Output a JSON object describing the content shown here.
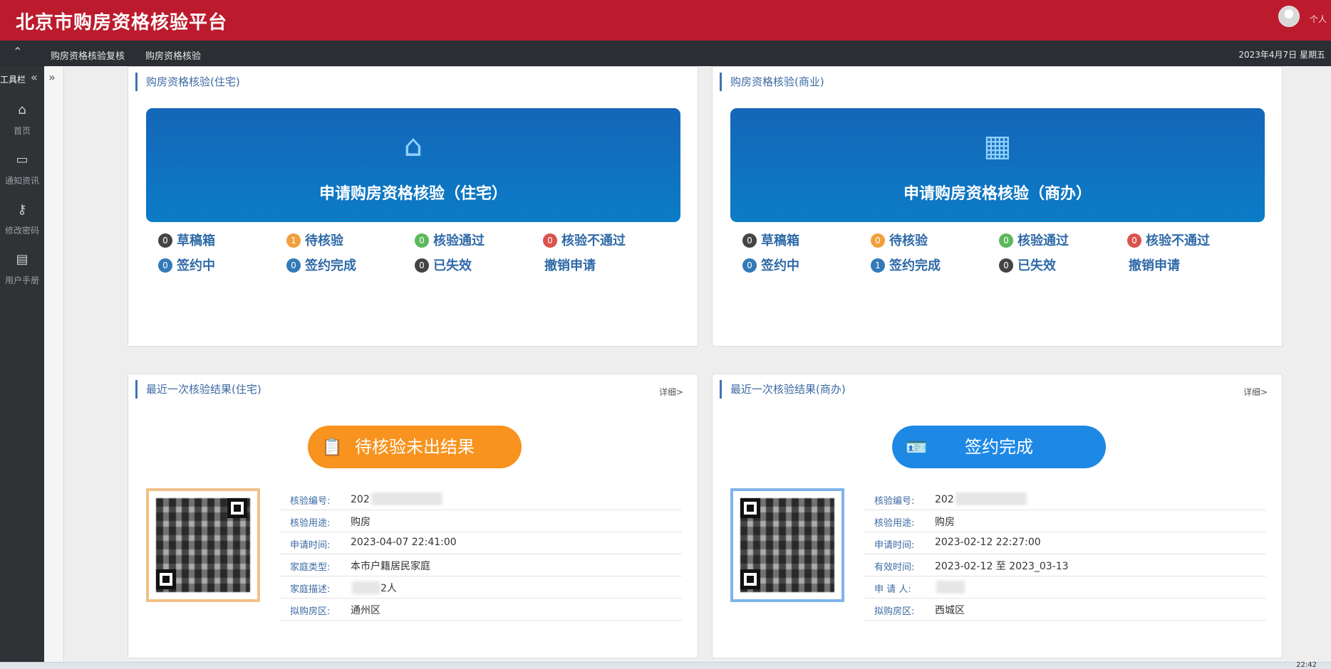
{
  "header": {
    "title": "北京市购房资格核验平台",
    "user_label": "个人",
    "avatar_icon": "user-avatar-icon"
  },
  "navbar": {
    "collapse_icon": "chevron-up-icon",
    "items": [
      "购房资格核验复核",
      "购房资格核验"
    ],
    "date": "2023年4月7日 星期五"
  },
  "sidebar": {
    "toolbar_label": "工具栏",
    "collapse_icon": "double-chevron-left-icon",
    "expand_icon": "double-chevron-right-icon",
    "items": [
      {
        "label": "首页",
        "icon": "home-icon"
      },
      {
        "label": "通知资讯",
        "icon": "laptop-icon"
      },
      {
        "label": "修改密码",
        "icon": "key-icon"
      },
      {
        "label": "用户手册",
        "icon": "book-icon"
      }
    ]
  },
  "residential": {
    "title": "购房资格核验(住宅)",
    "apply_label": "申请购房资格核验（住宅）",
    "apply_icon": "house-icon",
    "stats": [
      {
        "count": "0",
        "label": "草稿箱",
        "color": "#444444"
      },
      {
        "count": "1",
        "label": "待核验",
        "color": "#f0a03c"
      },
      {
        "count": "0",
        "label": "核验通过",
        "color": "#5cb85c"
      },
      {
        "count": "0",
        "label": "核验不通过",
        "color": "#d9534f"
      },
      {
        "count": "0",
        "label": "签约中",
        "color": "#337ab7"
      },
      {
        "count": "0",
        "label": "签约完成",
        "color": "#337ab7"
      },
      {
        "count": "0",
        "label": "已失效",
        "color": "#444444"
      }
    ],
    "revoke_label": "撤销申请"
  },
  "commercial": {
    "title": "购房资格核验(商业)",
    "apply_label": "申请购房资格核验（商办）",
    "apply_icon": "office-building-icon",
    "stats": [
      {
        "count": "0",
        "label": "草稿箱",
        "color": "#444444"
      },
      {
        "count": "0",
        "label": "待核验",
        "color": "#f0a03c"
      },
      {
        "count": "0",
        "label": "核验通过",
        "color": "#5cb85c"
      },
      {
        "count": "0",
        "label": "核验不通过",
        "color": "#d9534f"
      },
      {
        "count": "0",
        "label": "签约中",
        "color": "#337ab7"
      },
      {
        "count": "1",
        "label": "签约完成",
        "color": "#337ab7"
      },
      {
        "count": "0",
        "label": "已失效",
        "color": "#444444"
      }
    ],
    "revoke_label": "撤销申请"
  },
  "latest_residential": {
    "title": "最近一次核验结果(住宅)",
    "detail_link": "详细>",
    "status_label": "待核验未出结果",
    "status_color": "#f7931e",
    "status_icon": "clipboard-pending-icon",
    "rows": [
      {
        "key": "核验编号:",
        "value": "202"
      },
      {
        "key": "核验用途:",
        "value": "购房"
      },
      {
        "key": "申请时间:",
        "value": "2023-04-07 22:41:00"
      },
      {
        "key": "家庭类型:",
        "value": "本市户籍居民家庭"
      },
      {
        "key": "家庭描述:",
        "value": "2人"
      },
      {
        "key": "拟购房区:",
        "value": "通州区"
      }
    ]
  },
  "latest_commercial": {
    "title": "最近一次核验结果(商办)",
    "detail_link": "详细>",
    "status_label": "签约完成",
    "status_color": "#1e88e5",
    "status_icon": "contract-card-icon",
    "rows": [
      {
        "key": "核验编号:",
        "value": "202"
      },
      {
        "key": "核验用途:",
        "value": "购房"
      },
      {
        "key": "申请时间:",
        "value": "2023-02-12 22:27:00"
      },
      {
        "key": "有效时间:",
        "value": "2023-02-12 至 2023_03-13"
      },
      {
        "key": "申 请 人:",
        "value": ""
      },
      {
        "key": "拟购房区:",
        "value": "西城区"
      }
    ]
  },
  "taskbar": {
    "clock": "22:42"
  }
}
